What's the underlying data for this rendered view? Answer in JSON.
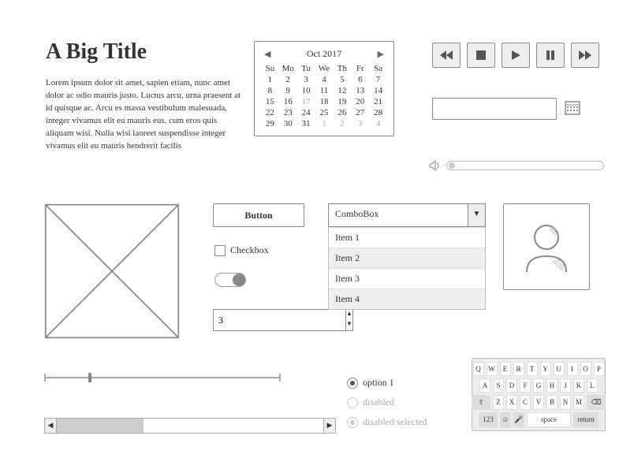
{
  "title": "A Big Title",
  "paragraph": "Lorem ipsum dolor sit amet, sapien etiam, nunc amet dolor ac odio mauris justo. Luctus arcu, urna praesent at id quisque ac. Arcu es massa vestibulum malesuada, integer vivamus elit eu mauris eus, cum eros quis aliquam wisi. Nulla wisi laoreet suspendisse integer vivamus elit eu mauris hendrerit facilis",
  "calendar": {
    "month_label": "Oct  2017",
    "days": [
      "Su",
      "Mo",
      "Tu",
      "We",
      "Th",
      "Fr",
      "Sa"
    ],
    "cells": [
      "1",
      "2",
      "3",
      "4",
      "5",
      "6",
      "7",
      "8",
      "9",
      "10",
      "11",
      "12",
      "13",
      "14",
      "15",
      "16",
      "17",
      "18",
      "19",
      "20",
      "21",
      "22",
      "23",
      "24",
      "25",
      "26",
      "27",
      "28",
      "29",
      "30",
      "31",
      "1",
      "2",
      "3",
      "4"
    ],
    "trailing_start_index": 31
  },
  "button_label": "Button",
  "checkbox_label": "Checkbox",
  "spinner_value": "3",
  "combo": {
    "label": "ComboBox",
    "items": [
      "Item 1",
      "Item 2",
      "Item 3",
      "Item 4"
    ]
  },
  "radios": {
    "option1": "option 1",
    "disabled": "disabled",
    "disabled_selected": "disabled selected"
  },
  "keyboard": {
    "row1": [
      "Q",
      "W",
      "E",
      "R",
      "T",
      "Y",
      "U",
      "I",
      "O",
      "P"
    ],
    "row2": [
      "A",
      "S",
      "D",
      "F",
      "G",
      "H",
      "J",
      "K",
      "L"
    ],
    "row3_shift": "⇧",
    "row3": [
      "Z",
      "X",
      "C",
      "V",
      "B",
      "N",
      "M"
    ],
    "row3_back": "⌫",
    "row4_123": "123",
    "row4_emoji": "☺",
    "row4_mic": "🎤",
    "row4_space": "space",
    "row4_return": "return"
  }
}
